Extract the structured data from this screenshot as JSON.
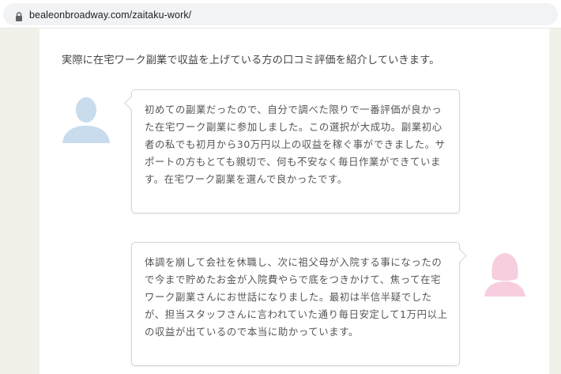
{
  "browser": {
    "url": "bealeonbroadway.com/zaitaku-work/",
    "lock_icon": "lock-icon"
  },
  "article": {
    "intro": "実際に在宅ワーク副業で収益を上げている方の口コミ評価を紹介していきます。",
    "reviews": [
      {
        "avatar_icon": "male-avatar-icon",
        "avatar_color": "#c8dcee",
        "text": "初めての副業だったので、自分で調べた限りで一番評価が良かった在宅ワーク副業に参加しました。この選択が大成功。副業初心者の私でも初月から30万円以上の収益を稼ぐ事ができました。サポートの方もとても親切で、何も不安なく毎日作業ができています。在宅ワーク副業を選んで良かったです。"
      },
      {
        "avatar_icon": "female-avatar-icon",
        "avatar_color": "#f7cedf",
        "text": "体調を崩して会社を休職し、次に祖父母が入院する事になったので今まで貯めたお金が入院費やらで底をつきかけて、焦って在宅ワーク副業さんにお世話になりました。最初は半信半疑でしたが、担当スタッフさんに言われていた通り毎日安定して1万円以上の収益が出ているので本当に助かっています。"
      }
    ]
  }
}
